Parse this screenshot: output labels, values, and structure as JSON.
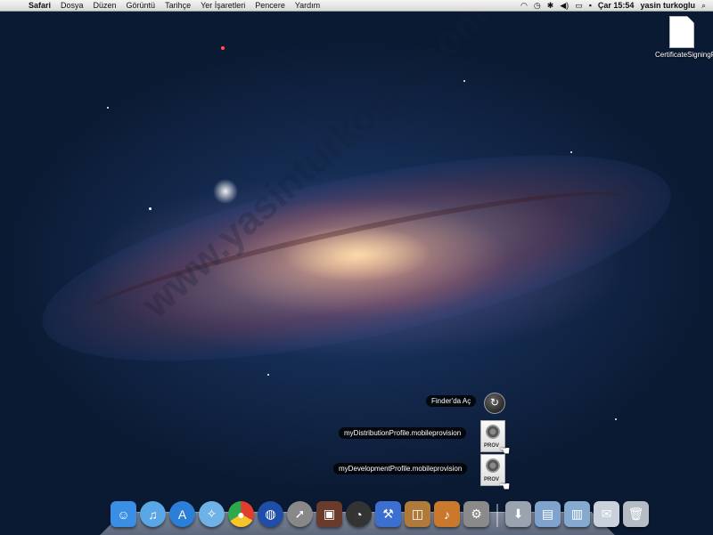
{
  "menubar": {
    "app_name": "Safari",
    "menus": [
      "Dosya",
      "Düzen",
      "Görüntü",
      "Tarihçe",
      "Yer İşaretleri",
      "Pencere",
      "Yardım"
    ],
    "clock": "Çar 15:54",
    "user": "yasin turkoglu"
  },
  "desktop": {
    "icon_label": "CertificateSigningR...quest"
  },
  "stack_popup": {
    "open_in_finder": "Finder'da Aç",
    "files": [
      {
        "name": "myDistributionProfile.mobileprovision",
        "tag": "PROV"
      },
      {
        "name": "myDevelopmentProfile.mobileprovision",
        "tag": "PROV"
      }
    ]
  },
  "watermark": "www.yasinturkoglu.com",
  "dock": {
    "items": [
      "finder-icon",
      "itunes-icon",
      "app-store-icon",
      "safari-icon",
      "chrome-icon",
      "google-earth-icon",
      "launchpad-icon",
      "photo-booth-icon",
      "dashboard-icon",
      "xcode-icon",
      "iphoto-icon",
      "garageband-icon",
      "system-preferences-icon"
    ],
    "stacks": [
      "downloads-stack-icon",
      "applications-folder-icon",
      "documents-folder-icon",
      "mail-preview-icon",
      "trash-icon"
    ],
    "colors": {
      "finder": "#3a8ee6",
      "itunes": "#5aa7e8",
      "appstore": "#2b7fd8",
      "safari": "#6fb2e8",
      "chrome": "#e33d2d",
      "earth": "#1f4ea8",
      "launch": "#888888",
      "photobooth": "#6a3a2a",
      "dashboard": "#333333",
      "xcode": "#3b6fd0",
      "iphoto": "#b07a3b",
      "garageband": "#c9782c",
      "sysprefs": "#8a8a8a"
    }
  }
}
